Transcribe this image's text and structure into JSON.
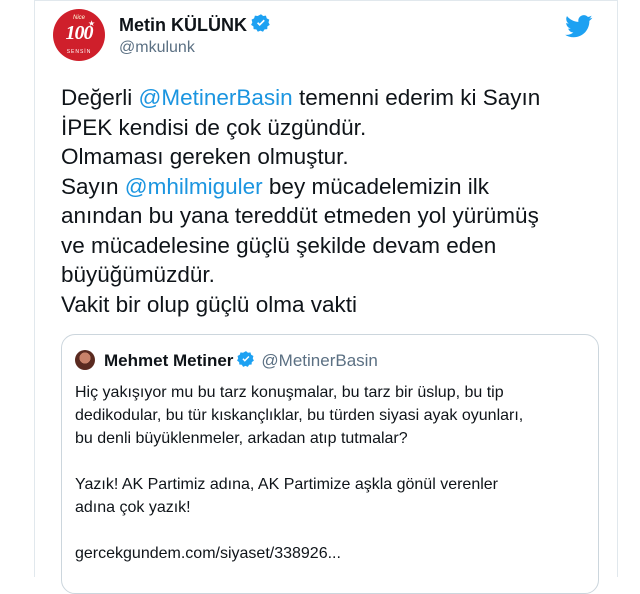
{
  "tweet": {
    "author_name": "Metin KÜLÜNK",
    "author_handle": "@mkulunk",
    "avatar": {
      "top_text": "Nice",
      "main_text": "100",
      "small_text": "SENSİN",
      "color": "#cf1f2b"
    },
    "lines": [
      [
        {
          "t": "Değerli "
        },
        {
          "t": "@MetinerBasin",
          "m": 1
        },
        {
          "t": " temenni ederim ki Sayın"
        }
      ],
      [
        {
          "t": "İPEK kendisi de çok üzgündür."
        }
      ],
      [
        {
          "t": "Olmaması  gereken  olmuştur."
        }
      ],
      [
        {
          "t": "Sayın "
        },
        {
          "t": "@mhilmiguler",
          "m": 1
        },
        {
          "t": " bey mücadelemizin ilk"
        }
      ],
      [
        {
          "t": "anından bu yana tereddüt etmeden yol yürümüş"
        }
      ],
      [
        {
          "t": "ve mücadelesine güçlü şekilde devam eden"
        }
      ],
      [
        {
          "t": "büyüğümüzdür."
        }
      ],
      [
        {
          "t": "Vakit bir olup güçlü olma vakti"
        }
      ]
    ]
  },
  "quote": {
    "author_name": "Mehmet Metiner",
    "author_handle": "@MetinerBasin",
    "lines": [
      "Hiç yakışıyor mu bu tarz konuşmalar, bu tarz bir üslup, bu tip",
      "dedikodular, bu tür kıskançlıklar, bu türden siyasi ayak oyunları,",
      "bu denli büyüklenmeler, arkadan atıp tutmalar?",
      "",
      "Yazık! AK Partimiz adına, AK Partimize aşkla gönül verenler",
      "adına çok yazık!",
      "",
      "gercekgundem.com/siyaset/338926..."
    ]
  },
  "colors": {
    "mention": "#1b95e0",
    "verified": "#1da1f2",
    "twitter_bird": "#1da1f2"
  },
  "icons": {
    "verified": "verified-badge-icon",
    "brand": "twitter-bird-icon"
  }
}
